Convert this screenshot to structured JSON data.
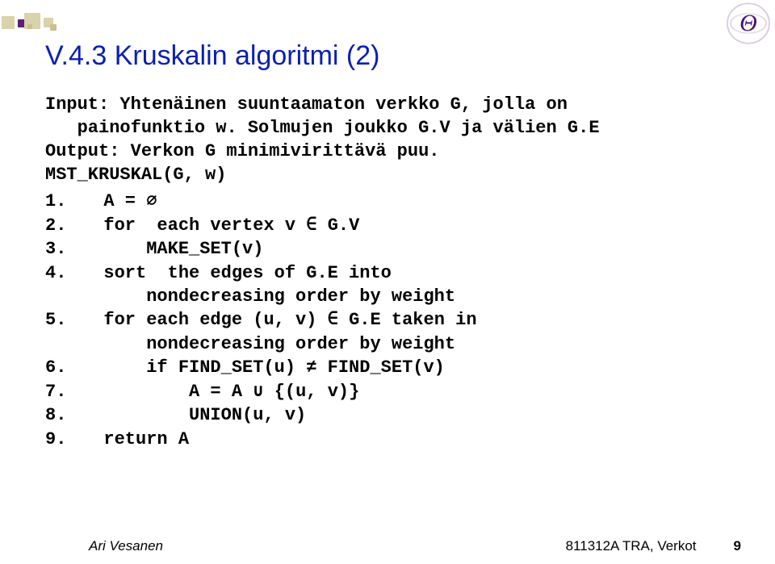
{
  "theta": "Θ",
  "title": "V.4.3 Kruskalin algoritmi (2)",
  "intro_lines": [
    "Input: Yhtenäinen suuntaamaton verkko G, jolla on",
    "   painofunktio w. Solmujen joukko G.V ja välien G.E",
    "Output: Verkon G minimivirittävä puu.",
    "MST_KRUSKAL(G, w)"
  ],
  "code_lines": [
    "  A = ∅",
    "  for  each vertex v ∈ G.V",
    "      MAKE_SET(v)",
    "  sort  the edges of G.E into\n      nondecreasing order by weight",
    "  for each edge (u, v) ∈ G.E taken in\n      nondecreasing order by weight",
    "      if FIND_SET(u) ≠ FIND_SET(v)",
    "          A = A ∪ {(u, v)}",
    "          UNION(u, v)",
    "  return A"
  ],
  "footer": {
    "author": "Ari Vesanen",
    "course": "811312A TRA, Verkot",
    "page": "9"
  }
}
